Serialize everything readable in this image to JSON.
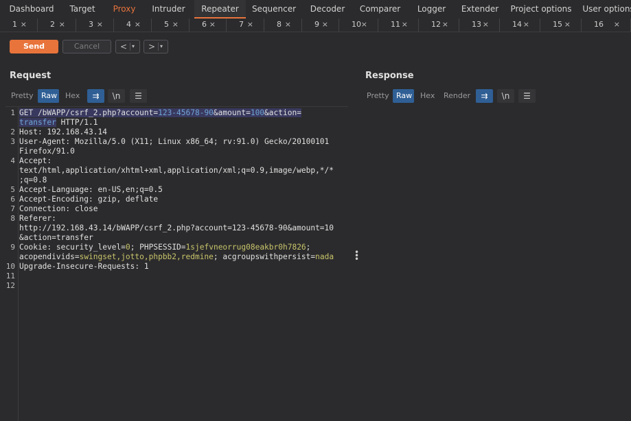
{
  "topnav": [
    {
      "label": "Dashboard"
    },
    {
      "label": "Target"
    },
    {
      "label": "Proxy"
    },
    {
      "label": "Intruder"
    },
    {
      "label": "Repeater"
    },
    {
      "label": "Sequencer"
    },
    {
      "label": "Decoder"
    },
    {
      "label": "Comparer"
    },
    {
      "label": "Logger"
    },
    {
      "label": "Extender"
    },
    {
      "label": "Project options"
    },
    {
      "label": "User options"
    }
  ],
  "subtabs": [
    "1",
    "2",
    "3",
    "4",
    "5",
    "6",
    "7",
    "8",
    "9",
    "10",
    "11",
    "12",
    "13",
    "14",
    "15",
    "16"
  ],
  "subtab_close": "×",
  "toolbar": {
    "send_label": "Send",
    "cancel_label": "Cancel",
    "prev_label": "<",
    "next_label": ">",
    "dropdown_glyph": "▾"
  },
  "request": {
    "title": "Request",
    "tabs": [
      {
        "label": "Pretty"
      },
      {
        "label": "Raw"
      },
      {
        "label": "Hex"
      }
    ],
    "selected_tab": "Raw",
    "icons": {
      "wrap": "⇉",
      "newline": "\\n",
      "menu": "☰"
    }
  },
  "response": {
    "title": "Response",
    "tabs": [
      {
        "label": "Pretty"
      },
      {
        "label": "Raw"
      },
      {
        "label": "Hex"
      },
      {
        "label": "Render"
      }
    ],
    "selected_tab": "Raw",
    "icons": {
      "wrap": "⇉",
      "newline": "\\n",
      "menu": "☰"
    }
  },
  "editor": {
    "line_numbers": [
      "1",
      "2",
      "3",
      "4",
      "5",
      "6",
      "7",
      "8",
      "9",
      "10",
      "11",
      "12"
    ],
    "lines": [
      {
        "parts": [
          [
            "GET /bWAPP/csrf_2.php?",
            "hlk"
          ],
          [
            "account",
            "hlk"
          ],
          [
            "=",
            "hlk"
          ],
          [
            "123-45678-90",
            "hlv"
          ],
          [
            "&amount",
            "hlk"
          ],
          [
            "=",
            "hlk"
          ],
          [
            "100",
            "hlv"
          ],
          [
            "&action",
            "hlk"
          ],
          [
            "=",
            "hlk"
          ]
        ]
      },
      {
        "parts": [
          [
            "transfer",
            "hlv"
          ],
          [
            " HTTP/1.1",
            "key"
          ]
        ]
      },
      {
        "parts": [
          [
            "Host",
            "key"
          ],
          [
            ": 192.168.43.14",
            "key"
          ]
        ]
      },
      {
        "parts": [
          [
            "User-Agent",
            "key"
          ],
          [
            ": Mozilla/5.0 (X11; Linux x86_64; rv:91.0) Gecko/20100101",
            "key"
          ]
        ]
      },
      {
        "parts": [
          [
            "Firefox/91.0",
            "key"
          ]
        ]
      },
      {
        "parts": [
          [
            "Accept",
            "key"
          ],
          [
            ":",
            "key"
          ]
        ]
      },
      {
        "parts": [
          [
            "text/html,application/xhtml+xml,application/xml;q=0.9,image/webp,*/*",
            "key"
          ]
        ]
      },
      {
        "parts": [
          [
            ";q=0.8",
            "key"
          ]
        ]
      },
      {
        "parts": [
          [
            "Accept-Language",
            "key"
          ],
          [
            ": en-US,en;q=0.5",
            "key"
          ]
        ]
      },
      {
        "parts": [
          [
            "Accept-Encoding",
            "key"
          ],
          [
            ": gzip, deflate",
            "key"
          ]
        ]
      },
      {
        "parts": [
          [
            "Connection",
            "key"
          ],
          [
            ": close",
            "key"
          ]
        ]
      },
      {
        "parts": [
          [
            "Referer",
            "key"
          ],
          [
            ":",
            "key"
          ]
        ]
      },
      {
        "parts": [
          [
            "http://192.168.43.14/bWAPP/csrf_2.php?account=123-45678-90&amount=10",
            "key"
          ]
        ]
      },
      {
        "parts": [
          [
            "&action=transfer",
            "key"
          ]
        ]
      },
      {
        "parts": [
          [
            "Cookie",
            "key"
          ],
          [
            ": security_level",
            "key"
          ],
          [
            "=",
            "key"
          ],
          [
            "0",
            "grn"
          ],
          [
            "; PHPSESSID",
            "key"
          ],
          [
            "=",
            "key"
          ],
          [
            "1sjefvneorrug08eakbr0h7826",
            "grn"
          ],
          [
            ";",
            "key"
          ]
        ]
      },
      {
        "parts": [
          [
            "acopendivids",
            "key"
          ],
          [
            "=",
            "key"
          ],
          [
            "swingset,jotto,phpbb2,redmine",
            "grn"
          ],
          [
            "; acgroupswithpersist",
            "key"
          ],
          [
            "=",
            "key"
          ],
          [
            "nada",
            "grn"
          ]
        ]
      },
      {
        "parts": [
          [
            "Upgrade-Insecure-Requests",
            "key"
          ],
          [
            ": 1",
            "key"
          ]
        ]
      }
    ]
  },
  "colors": {
    "accent": "#e8743b",
    "selected": "#2f5f95",
    "background": "#2b2b2d"
  }
}
